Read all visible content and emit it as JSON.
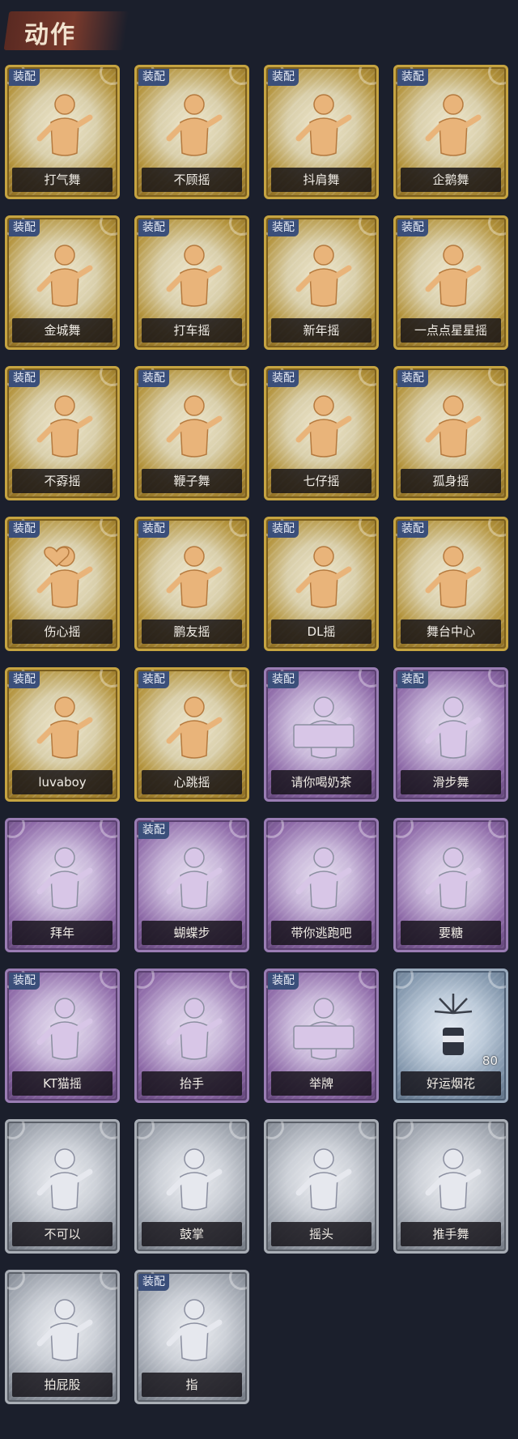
{
  "title": "动作",
  "equip_badge": "装配",
  "colors": {
    "gold": "#c6a441",
    "purple": "#9a7db4",
    "silver": "#a9aeb6",
    "blue": "#9aabbd",
    "badge": "#3b4f7a"
  },
  "items": [
    {
      "name": "打气舞",
      "tier": "gold",
      "equipped": true,
      "icon": "dancer-icon"
    },
    {
      "name": "不顾摇",
      "tier": "gold",
      "equipped": true,
      "icon": "dancer-icon"
    },
    {
      "name": "抖肩舞",
      "tier": "gold",
      "equipped": true,
      "icon": "dancer-icon"
    },
    {
      "name": "企鹅舞",
      "tier": "gold",
      "equipped": true,
      "icon": "dancer-icon"
    },
    {
      "name": "金城舞",
      "tier": "gold",
      "equipped": true,
      "icon": "dancer-icon"
    },
    {
      "name": "打车摇",
      "tier": "gold",
      "equipped": true,
      "icon": "dancer-icon"
    },
    {
      "name": "新年摇",
      "tier": "gold",
      "equipped": true,
      "icon": "dancer-icon"
    },
    {
      "name": "一点点星星摇",
      "tier": "gold",
      "equipped": true,
      "icon": "dancer-icon"
    },
    {
      "name": "不孬摇",
      "tier": "gold",
      "equipped": true,
      "icon": "dancer-icon"
    },
    {
      "name": "鞭子舞",
      "tier": "gold",
      "equipped": true,
      "icon": "dancer-icon"
    },
    {
      "name": "七仔摇",
      "tier": "gold",
      "equipped": true,
      "icon": "dancer-icon"
    },
    {
      "name": "孤身摇",
      "tier": "gold",
      "equipped": true,
      "icon": "dancer-icon"
    },
    {
      "name": "伤心摇",
      "tier": "gold",
      "equipped": true,
      "icon": "heart-hands-icon"
    },
    {
      "name": "鹏友摇",
      "tier": "gold",
      "equipped": true,
      "icon": "dancer-icon"
    },
    {
      "name": "DL摇",
      "tier": "gold",
      "equipped": true,
      "icon": "dancer-icon"
    },
    {
      "name": "舞台中心",
      "tier": "gold",
      "equipped": true,
      "icon": "dancer-icon"
    },
    {
      "name": "luvaboy",
      "tier": "gold",
      "equipped": true,
      "icon": "dancer-icon"
    },
    {
      "name": "心跳摇",
      "tier": "gold",
      "equipped": true,
      "icon": "dancer-icon"
    },
    {
      "name": "请你喝奶茶",
      "tier": "purple",
      "equipped": true,
      "icon": "sign-holder-icon"
    },
    {
      "name": "滑步舞",
      "tier": "purple",
      "equipped": true,
      "icon": "dancer-icon"
    },
    {
      "name": "拜年",
      "tier": "purple",
      "equipped": false,
      "icon": "bow-icon"
    },
    {
      "name": "蝴蝶步",
      "tier": "purple",
      "equipped": true,
      "icon": "dancer-icon"
    },
    {
      "name": "带你逃跑吧",
      "tier": "purple",
      "equipped": false,
      "icon": "dancer-icon"
    },
    {
      "name": "要糖",
      "tier": "purple",
      "equipped": false,
      "icon": "reach-icon"
    },
    {
      "name": "KT猫摇",
      "tier": "purple",
      "equipped": true,
      "icon": "dancer-icon"
    },
    {
      "name": "抬手",
      "tier": "purple",
      "equipped": false,
      "icon": "reach-icon"
    },
    {
      "name": "举牌",
      "tier": "purple",
      "equipped": true,
      "icon": "sign-holder-icon"
    },
    {
      "name": "好运烟花",
      "tier": "blue",
      "equipped": false,
      "icon": "firework-icon",
      "count": "80"
    },
    {
      "name": "不可以",
      "tier": "silver",
      "equipped": false,
      "icon": "finger-icon"
    },
    {
      "name": "鼓掌",
      "tier": "silver",
      "equipped": false,
      "icon": "clap-icon"
    },
    {
      "name": "摇头",
      "tier": "silver",
      "equipped": false,
      "icon": "dancer-icon"
    },
    {
      "name": "推手舞",
      "tier": "silver",
      "equipped": false,
      "icon": "dancer-icon"
    },
    {
      "name": "拍屁股",
      "tier": "silver",
      "equipped": false,
      "icon": "walk-icon"
    },
    {
      "name": "指",
      "tier": "silver",
      "equipped": true,
      "icon": "point-icon"
    }
  ]
}
